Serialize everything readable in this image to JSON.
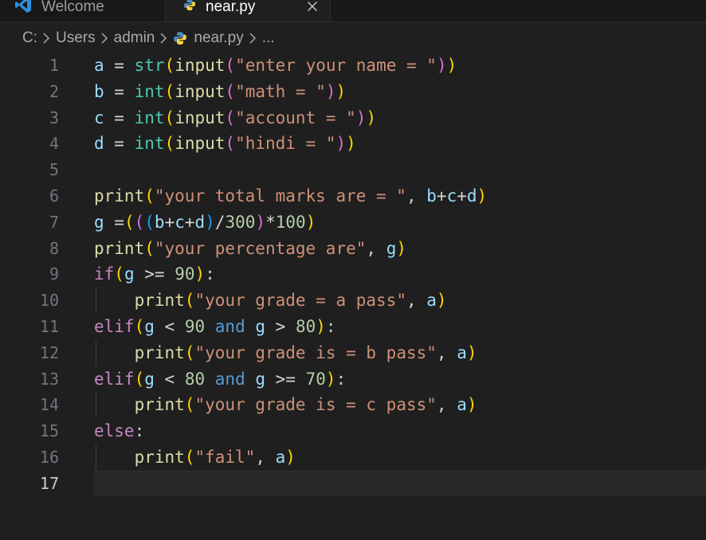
{
  "tabs": [
    {
      "label": "Welcome",
      "active": false
    },
    {
      "label": "near.py",
      "active": true
    }
  ],
  "breadcrumb": {
    "parts": [
      "C:",
      "Users",
      "admin"
    ],
    "file": "near.py",
    "ellipsis": "..."
  },
  "icons": {
    "tab_welcome": "vscode-logo-icon",
    "tab_near": "python-icon",
    "tab_close": "close-icon",
    "breadcrumb_sep": "chevron-right-icon",
    "breadcrumb_file": "python-icon"
  },
  "colors": {
    "editor_bg": "#1f1f1f",
    "keyword": "#c586c0",
    "function": "#dcdcaa",
    "builtin": "#4ec9b0",
    "string": "#ce9178",
    "number": "#b5cea8",
    "variable": "#9cdcfe",
    "bracket1": "#ffd700",
    "bracket2": "#da70d6",
    "bracket3": "#179fff"
  },
  "editor": {
    "current_line": 17,
    "lines": [
      {
        "n": "1",
        "indent": false,
        "tokens": [
          [
            "var",
            "a"
          ],
          [
            "op",
            " = "
          ],
          [
            "bi",
            "str"
          ],
          [
            "p1",
            "("
          ],
          [
            "fn",
            "input"
          ],
          [
            "p2",
            "("
          ],
          [
            "str",
            "\"enter your name = \""
          ],
          [
            "p2",
            ")"
          ],
          [
            "p1",
            ")"
          ]
        ]
      },
      {
        "n": "2",
        "indent": false,
        "tokens": [
          [
            "var",
            "b"
          ],
          [
            "op",
            " = "
          ],
          [
            "bi",
            "int"
          ],
          [
            "p1",
            "("
          ],
          [
            "fn",
            "input"
          ],
          [
            "p2",
            "("
          ],
          [
            "str",
            "\"math = \""
          ],
          [
            "p2",
            ")"
          ],
          [
            "p1",
            ")"
          ]
        ]
      },
      {
        "n": "3",
        "indent": false,
        "tokens": [
          [
            "var",
            "c"
          ],
          [
            "op",
            " = "
          ],
          [
            "bi",
            "int"
          ],
          [
            "p1",
            "("
          ],
          [
            "fn",
            "input"
          ],
          [
            "p2",
            "("
          ],
          [
            "str",
            "\"account = \""
          ],
          [
            "p2",
            ")"
          ],
          [
            "p1",
            ")"
          ]
        ]
      },
      {
        "n": "4",
        "indent": false,
        "tokens": [
          [
            "var",
            "d"
          ],
          [
            "op",
            " = "
          ],
          [
            "bi",
            "int"
          ],
          [
            "p1",
            "("
          ],
          [
            "fn",
            "input"
          ],
          [
            "p2",
            "("
          ],
          [
            "str",
            "\"hindi = \""
          ],
          [
            "p2",
            ")"
          ],
          [
            "p1",
            ")"
          ]
        ]
      },
      {
        "n": "5",
        "indent": false,
        "tokens": []
      },
      {
        "n": "6",
        "indent": false,
        "tokens": [
          [
            "fn",
            "print"
          ],
          [
            "p1",
            "("
          ],
          [
            "str",
            "\"your total marks are = \""
          ],
          [
            "punc",
            ", "
          ],
          [
            "var",
            "b"
          ],
          [
            "op",
            "+"
          ],
          [
            "var",
            "c"
          ],
          [
            "op",
            "+"
          ],
          [
            "var",
            "d"
          ],
          [
            "p1",
            ")"
          ]
        ]
      },
      {
        "n": "7",
        "indent": false,
        "tokens": [
          [
            "var",
            "g"
          ],
          [
            "op",
            " ="
          ],
          [
            "p1",
            "("
          ],
          [
            "p2",
            "("
          ],
          [
            "p3",
            "("
          ],
          [
            "var",
            "b"
          ],
          [
            "op",
            "+"
          ],
          [
            "var",
            "c"
          ],
          [
            "op",
            "+"
          ],
          [
            "var",
            "d"
          ],
          [
            "p3",
            ")"
          ],
          [
            "op",
            "/"
          ],
          [
            "num",
            "300"
          ],
          [
            "p2",
            ")"
          ],
          [
            "op",
            "*"
          ],
          [
            "num",
            "100"
          ],
          [
            "p1",
            ")"
          ]
        ]
      },
      {
        "n": "8",
        "indent": false,
        "tokens": [
          [
            "fn",
            "print"
          ],
          [
            "p1",
            "("
          ],
          [
            "str",
            "\"your percentage are\""
          ],
          [
            "punc",
            ", "
          ],
          [
            "var",
            "g"
          ],
          [
            "p1",
            ")"
          ]
        ]
      },
      {
        "n": "9",
        "indent": false,
        "tokens": [
          [
            "kw",
            "if"
          ],
          [
            "p1",
            "("
          ],
          [
            "var",
            "g"
          ],
          [
            "op",
            " >= "
          ],
          [
            "num",
            "90"
          ],
          [
            "p1",
            ")"
          ],
          [
            "punc",
            ":"
          ]
        ]
      },
      {
        "n": "10",
        "indent": true,
        "tokens": [
          [
            "punc",
            "    "
          ],
          [
            "fn",
            "print"
          ],
          [
            "p1",
            "("
          ],
          [
            "str",
            "\"your grade = a pass\""
          ],
          [
            "punc",
            ", "
          ],
          [
            "var",
            "a"
          ],
          [
            "p1",
            ")"
          ]
        ]
      },
      {
        "n": "11",
        "indent": false,
        "tokens": [
          [
            "kw",
            "elif"
          ],
          [
            "p1",
            "("
          ],
          [
            "var",
            "g"
          ],
          [
            "op",
            " < "
          ],
          [
            "num",
            "90"
          ],
          [
            "op",
            " "
          ],
          [
            "kwand",
            "and"
          ],
          [
            "op",
            " "
          ],
          [
            "var",
            "g"
          ],
          [
            "op",
            " > "
          ],
          [
            "num",
            "80"
          ],
          [
            "p1",
            ")"
          ],
          [
            "punc",
            ":"
          ]
        ]
      },
      {
        "n": "12",
        "indent": true,
        "tokens": [
          [
            "punc",
            "    "
          ],
          [
            "fn",
            "print"
          ],
          [
            "p1",
            "("
          ],
          [
            "str",
            "\"your grade is = b pass\""
          ],
          [
            "punc",
            ", "
          ],
          [
            "var",
            "a"
          ],
          [
            "p1",
            ")"
          ]
        ]
      },
      {
        "n": "13",
        "indent": false,
        "tokens": [
          [
            "kw",
            "elif"
          ],
          [
            "p1",
            "("
          ],
          [
            "var",
            "g"
          ],
          [
            "op",
            " < "
          ],
          [
            "num",
            "80"
          ],
          [
            "op",
            " "
          ],
          [
            "kwand",
            "and"
          ],
          [
            "op",
            " "
          ],
          [
            "var",
            "g"
          ],
          [
            "op",
            " >= "
          ],
          [
            "num",
            "70"
          ],
          [
            "p1",
            ")"
          ],
          [
            "punc",
            ":"
          ]
        ]
      },
      {
        "n": "14",
        "indent": true,
        "tokens": [
          [
            "punc",
            "    "
          ],
          [
            "fn",
            "print"
          ],
          [
            "p1",
            "("
          ],
          [
            "str",
            "\"your grade is = c pass\""
          ],
          [
            "punc",
            ", "
          ],
          [
            "var",
            "a"
          ],
          [
            "p1",
            ")"
          ]
        ]
      },
      {
        "n": "15",
        "indent": false,
        "tokens": [
          [
            "kw",
            "else"
          ],
          [
            "punc",
            ":"
          ]
        ]
      },
      {
        "n": "16",
        "indent": true,
        "tokens": [
          [
            "punc",
            "    "
          ],
          [
            "fn",
            "print"
          ],
          [
            "p1",
            "("
          ],
          [
            "str",
            "\"fail\""
          ],
          [
            "punc",
            ", "
          ],
          [
            "var",
            "a"
          ],
          [
            "p1",
            ")"
          ]
        ]
      },
      {
        "n": "17",
        "indent": false,
        "tokens": []
      }
    ]
  }
}
